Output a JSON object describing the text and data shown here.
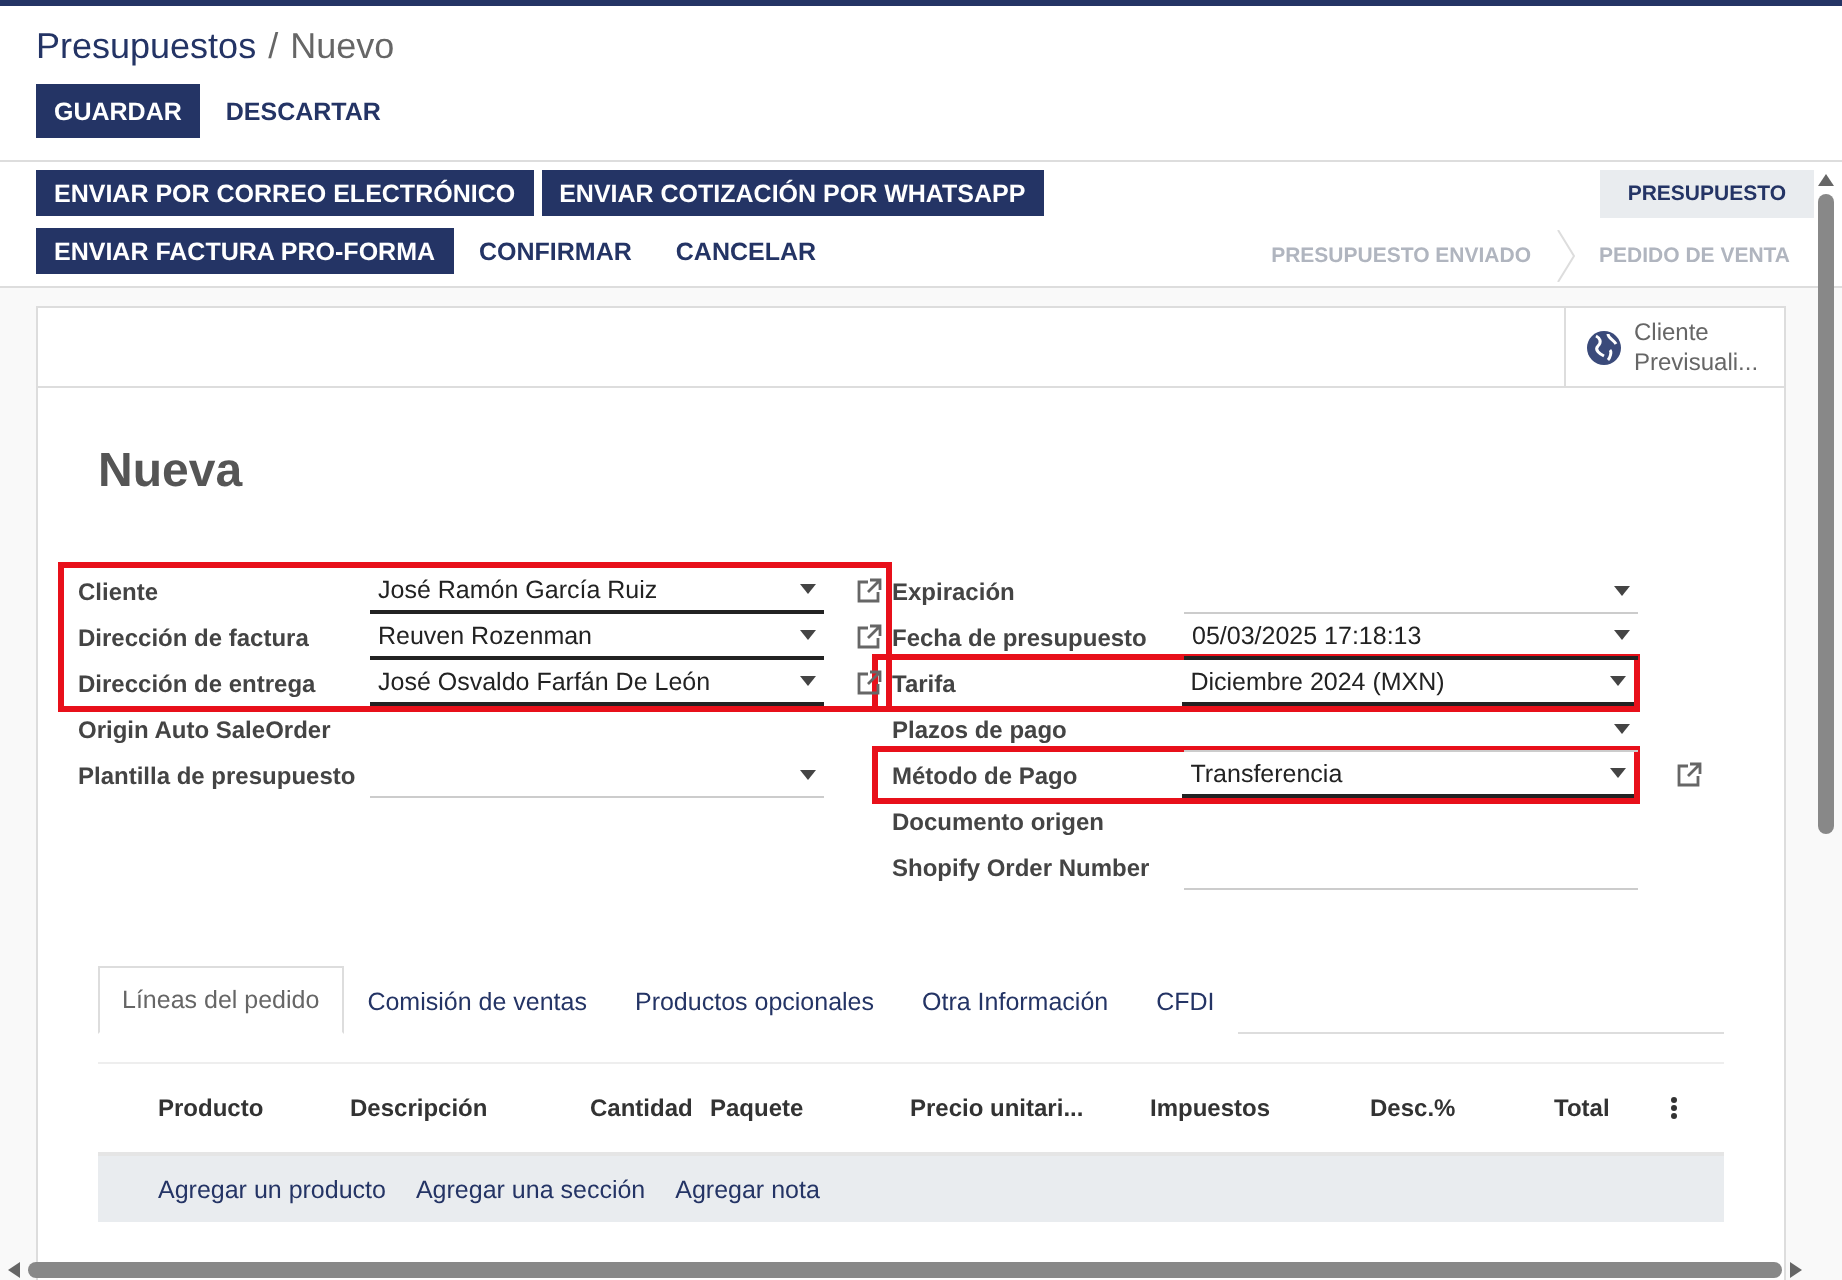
{
  "breadcrumb": {
    "parent": "Presupuestos",
    "separator": "/",
    "current": "Nuevo"
  },
  "actions": [
    {
      "label": "GUARDAR",
      "primary": true
    },
    {
      "label": "DESCARTAR",
      "primary": false
    }
  ],
  "header_buttons": [
    [
      {
        "label": "ENVIAR POR CORREO ELECTRÓNICO",
        "primary": true
      },
      {
        "label": "ENVIAR COTIZACIÓN POR WHATSAPP",
        "primary": true
      }
    ],
    [
      {
        "label": "ENVIAR FACTURA PRO-FORMA",
        "primary": true
      },
      {
        "label": "CONFIRMAR",
        "primary": false
      },
      {
        "label": "CANCELAR",
        "primary": false
      }
    ]
  ],
  "status_steps": [
    {
      "label": "PRESUPUESTO",
      "selected": true
    },
    {
      "label": "PRESUPUESTO ENVIADO",
      "selected": false
    },
    {
      "label": "PEDIDO DE VENTA",
      "selected": false
    }
  ],
  "smart_button": {
    "line1": "Cliente",
    "line2": "Previsuali..."
  },
  "title": "Nueva",
  "left_groups": [
    {
      "highlighted": true,
      "fields": [
        {
          "label": "Cliente",
          "kind": "select",
          "value": "José Ramón García Ruiz",
          "link": true
        },
        {
          "label": "Dirección de factura",
          "kind": "select",
          "value": "Reuven Rozenman",
          "link": true
        },
        {
          "label": "Dirección de entrega",
          "kind": "select",
          "value": "José Osvaldo Farfán De León",
          "link": true
        }
      ]
    },
    {
      "highlighted": false,
      "fields": [
        {
          "label": "Origin Auto SaleOrder",
          "kind": "none",
          "link": false
        },
        {
          "label": "Plantilla de presupuesto",
          "kind": "select",
          "link": false
        }
      ]
    }
  ],
  "right_fields": [
    {
      "label": "Expiración",
      "kind": "select",
      "link": false,
      "highlighted": false
    },
    {
      "label": "Fecha de presupuesto",
      "kind": "select",
      "value": "05/03/2025 17:18:13",
      "link": false,
      "highlighted": false
    },
    {
      "label": "Tarifa",
      "kind": "select",
      "value": "Diciembre 2024 (MXN)",
      "link": false,
      "highlighted": true
    },
    {
      "label": "Plazos de pago",
      "kind": "select",
      "link": false,
      "highlighted": false
    },
    {
      "label": "Método de Pago",
      "kind": "select",
      "value": "Transferencia",
      "link": true,
      "highlighted": true
    },
    {
      "label": "Documento origen",
      "kind": "none",
      "link": false,
      "highlighted": false
    },
    {
      "label": "Shopify Order Number",
      "kind": "input",
      "link": false,
      "highlighted": false
    }
  ],
  "tabs": [
    {
      "label": "Líneas del pedido",
      "selected": true
    },
    {
      "label": "Comisión de ventas",
      "selected": false
    },
    {
      "label": "Productos opcionales",
      "selected": false
    },
    {
      "label": "Otra Información",
      "selected": false
    },
    {
      "label": "CFDI",
      "selected": false
    }
  ],
  "table": {
    "columns": [
      "Producto",
      "Descripción",
      "Cantidad",
      "Paquete",
      "Precio unitari...",
      "Impuestos",
      "Desc.%",
      "Total"
    ],
    "add_links": [
      "Agregar un producto",
      "Agregar una sección",
      "Agregar nota"
    ]
  }
}
